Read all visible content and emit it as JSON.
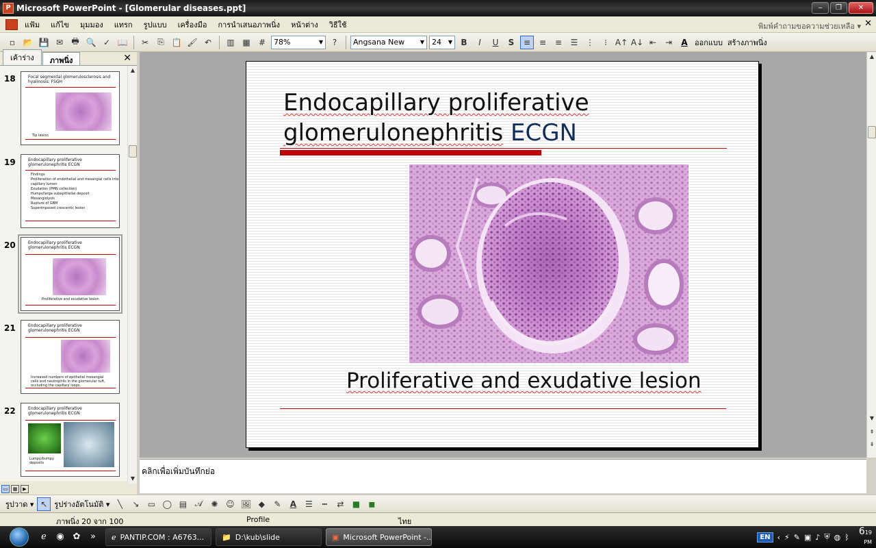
{
  "window": {
    "title": "Microsoft PowerPoint - [Glomerular diseases.ppt]",
    "app_icon": "P"
  },
  "menu": {
    "items": [
      "แฟ้ม",
      "แก้ไข",
      "มุมมอง",
      "แทรก",
      "รูปแบบ",
      "เครื่องมือ",
      "การนำเสนอภาพนิ่ง",
      "หน้าต่าง",
      "วิธีใช้"
    ],
    "help_placeholder": "พิมพ์คำถามขอความช่วยเหลือ"
  },
  "toolbar": {
    "zoom": "78%",
    "font_name": "Angsana New",
    "font_size": "24",
    "bold": "B",
    "italic": "I",
    "underline": "U",
    "shadow": "S",
    "design_label": "ออกแบบ",
    "new_slide_label": "สร้างภาพนิ่ง"
  },
  "left_pane": {
    "tabs": [
      "เค้าร่าง",
      "ภาพนิ่ง"
    ],
    "active_tab": "ภาพนิ่ง",
    "thumbnails": [
      {
        "number": "18",
        "title": "Focal segmental glomerulosclerosis and hyalinosis: FSGH",
        "caption": "Tip lesion"
      },
      {
        "number": "19",
        "title": "Endocapillary proliferative glomerulonephritis ECGN",
        "bullets": [
          "Findings",
          "Proliferation of endothelial and mesangial cells into capillary lumen",
          "Exudation (PMN collection)",
          "Humps/large subepithelial deposit",
          "Mesangiolysis",
          "Rupture of GBM",
          "Superimposed crescentic lesion"
        ]
      },
      {
        "number": "20",
        "title": "Endocapillary proliferative glomerulonephritis ECGN",
        "caption": "Proliferative and exudative lesion"
      },
      {
        "number": "21",
        "title": "Endocapillary proliferative glomerulonephritis ECGN",
        "caption": "Increased numbers of epithelial mesangial cells and neutrophils in the glomerular tuft, occluding the capillary loops."
      },
      {
        "number": "22",
        "title": "Endocapillary proliferative glomerulonephritis ECGN",
        "caption": "Lumpy/bumpy deposits"
      }
    ]
  },
  "slide": {
    "title_line1": "Endocapillary proliferative",
    "title_line2_a": "glomerulonephritis",
    "title_line2_b": "ECGN",
    "caption": "Proliferative and exudative lesion"
  },
  "notes": {
    "placeholder": "คลิกเพื่อเพิ่มบันทึกย่อ"
  },
  "drawbar": {
    "draw_label": "รูปวาด",
    "autoshapes_label": "รูปร่างอัตโนมัติ"
  },
  "status": {
    "slide_position": "ภาพนิ่ง 20 จาก 100",
    "design": "Profile",
    "language": "ไทย"
  },
  "taskbar": {
    "tasks": [
      "PANTIP.COM : A6763...",
      "D:\\kub\\slide",
      "Microsoft PowerPoint -..."
    ],
    "active_task": "Microsoft PowerPoint -...",
    "language": "EN",
    "clock_hour": "6",
    "clock_min": "19",
    "clock_ampm": "PM"
  },
  "colors": {
    "accent_red": "#c00000",
    "title_accent": "#0f2f5a",
    "thumb_active": "#a0a0a0"
  }
}
